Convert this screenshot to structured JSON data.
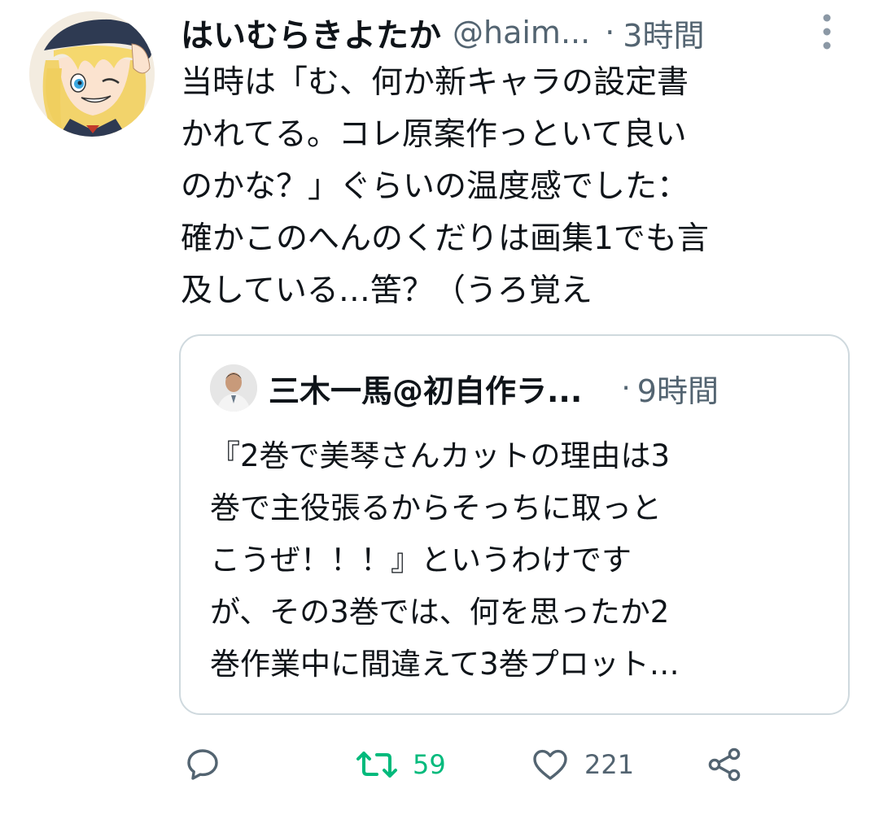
{
  "tweet": {
    "display_name": "はいむらきよたか",
    "handle": "@haim...",
    "separator": "·",
    "time": "3時間",
    "text_lines": [
      "当時は「む、何か新キャラの設定書",
      "かれてる。コレ原案作っといて良い",
      "のかな？」ぐらいの温度感でした：",
      "確かこのへんのくだりは画集1でも言",
      "及している…筈？（うろ覚え"
    ]
  },
  "quote": {
    "display_name": "三木一馬@初自作ラ...",
    "separator": "·",
    "time": "9時間",
    "text_lines": [
      "『2巻で美琴さんカットの理由は3",
      "巻で主役張るからそっちに取っと",
      "こうぜ！！！』というわけです",
      "が、その3巻では、何を思ったか2",
      "巻作業中に間違えて3巻プロット…"
    ]
  },
  "actions": {
    "reply_icon": "reply-icon",
    "retweet_icon": "retweet-icon",
    "retweet_count": "59",
    "like_icon": "heart-icon",
    "like_count": "221",
    "share_icon": "share-icon"
  },
  "colors": {
    "retweet_active": "#00ba7c",
    "secondary_text": "#536471",
    "primary_text": "#0f1419",
    "card_border": "#cfd9de"
  }
}
